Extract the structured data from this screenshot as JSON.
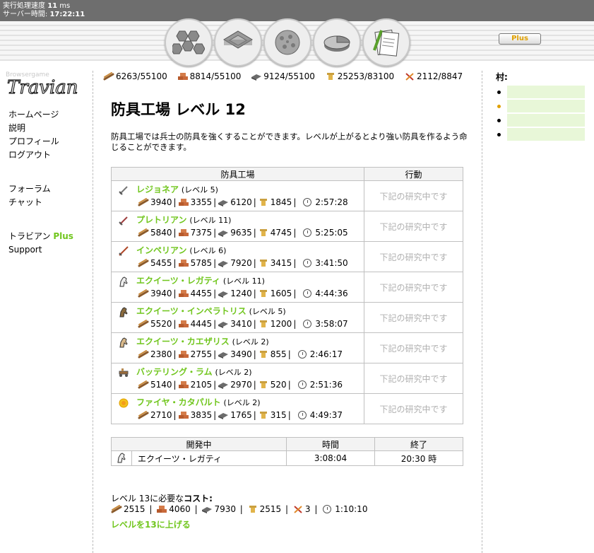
{
  "header": {
    "perf_label": "実行処理速度",
    "perf_value": "11",
    "perf_unit": "ms",
    "time_label": "サーバー時間:",
    "time_value": "17:22:11",
    "plus_button": "Plus"
  },
  "nav_icons": [
    "village-overview-icon",
    "village-center-icon",
    "map-icon",
    "statistics-icon",
    "reports-icon"
  ],
  "logo_text": "Travian",
  "left_menu": {
    "group1": [
      "ホームページ",
      "説明",
      "プロフィール",
      "ログアウト"
    ],
    "group2": [
      "フォーラム",
      "チャット"
    ],
    "plus_prefix": "トラビアン",
    "plus_word": "Plus",
    "support": "Support"
  },
  "resources": [
    {
      "icon": "wood-icon",
      "value": "6263/55100"
    },
    {
      "icon": "clay-icon",
      "value": "8814/55100"
    },
    {
      "icon": "iron-icon",
      "value": "9124/55100"
    },
    {
      "icon": "crop-icon",
      "value": "25253/83100"
    },
    {
      "icon": "consumption-icon",
      "value": "2112/8847"
    }
  ],
  "page_title": "防具工場 レベル 12",
  "description": "防具工場では兵士の防具を強くすることができます。レベルが上がるとより強い防具を作るよう命じることができます。",
  "research_table": {
    "col1": "防具工場",
    "col2": "行動",
    "rows": [
      {
        "icon": "legionnaire-icon",
        "name": "レジョネア",
        "level": "(レベル 5)",
        "wood": "3940",
        "clay": "3355",
        "iron": "6120",
        "crop": "1845",
        "time": "2:57:28",
        "action": "下記の研究中です"
      },
      {
        "icon": "praetorian-icon",
        "name": "プレトリアン",
        "level": "(レベル 11)",
        "wood": "5840",
        "clay": "7375",
        "iron": "9635",
        "crop": "4745",
        "time": "5:25:05",
        "action": "下記の研究中です"
      },
      {
        "icon": "imperian-icon",
        "name": "インペリアン",
        "level": "(レベル 6)",
        "wood": "5455",
        "clay": "5785",
        "iron": "7920",
        "crop": "3415",
        "time": "3:41:50",
        "action": "下記の研究中です"
      },
      {
        "icon": "equites-legati-icon",
        "name": "エクイーツ・レガティ",
        "level": "(レベル 11)",
        "wood": "3940",
        "clay": "4455",
        "iron": "1240",
        "crop": "1605",
        "time": "4:44:36",
        "action": "下記の研究中です"
      },
      {
        "icon": "equites-imperatoris-icon",
        "name": "エクイーツ・インペラトリス",
        "level": "(レベル 5)",
        "wood": "5520",
        "clay": "4445",
        "iron": "3410",
        "crop": "1200",
        "time": "3:58:07",
        "action": "下記の研究中です"
      },
      {
        "icon": "equites-caesaris-icon",
        "name": "エクイーツ・カエザリス",
        "level": "(レベル 2)",
        "wood": "2380",
        "clay": "2755",
        "iron": "3490",
        "crop": "855",
        "time": "2:46:17",
        "action": "下記の研究中です"
      },
      {
        "icon": "battering-ram-icon",
        "name": "バッテリング・ラム",
        "level": "(レベル 2)",
        "wood": "5140",
        "clay": "2105",
        "iron": "2970",
        "crop": "520",
        "time": "2:51:36",
        "action": "下記の研究中です"
      },
      {
        "icon": "fire-catapult-icon",
        "name": "ファイヤ・カタパルト",
        "level": "(レベル 2)",
        "wood": "2710",
        "clay": "3835",
        "iron": "1765",
        "crop": "315",
        "time": "4:49:37",
        "action": "下記の研究中です"
      }
    ]
  },
  "dev_table": {
    "col1": "開発中",
    "col2": "時間",
    "col3": "終了",
    "row": {
      "icon": "equites-legati-icon",
      "name": "エクイーツ・レガティ",
      "time": "3:08:04",
      "end": "20:30 時"
    }
  },
  "upgrade_cost": {
    "label_prefix": "レベル 13に必要な",
    "label_bold": "コスト:",
    "wood": "2515",
    "clay": "4060",
    "iron": "7930",
    "crop": "2515",
    "consumption": "3",
    "time": "1:10:10",
    "link": "レベルを13に上げる"
  },
  "villages": {
    "title": "村:",
    "count_items": 4
  },
  "colors": {
    "accent_green": "#71c61e",
    "plus_gold": "#e0a000",
    "topbar": "#6e6e6e"
  }
}
